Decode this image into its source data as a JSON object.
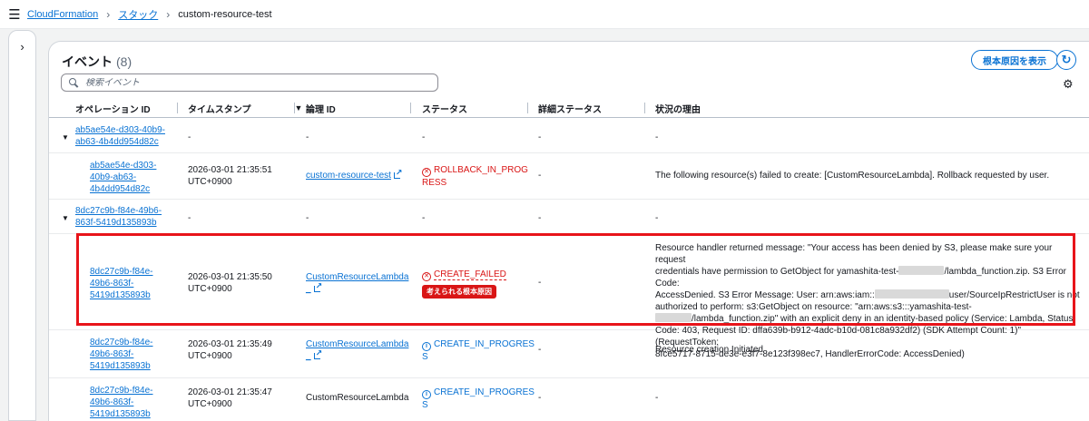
{
  "breadcrumb": {
    "items": [
      {
        "label": "CloudFormation"
      },
      {
        "label": "スタック"
      }
    ],
    "current": "custom-resource-test"
  },
  "panel": {
    "title": "イベント",
    "count": "(8)",
    "root_cause_button": "根本原因を表示",
    "search_placeholder": "検索イベント"
  },
  "table": {
    "headers": {
      "operation_id": "オペレーション ID",
      "timestamp": "タイムスタンプ",
      "logical_id": "論理 ID",
      "status": "ステータス",
      "detailed_status": "詳細ステータス",
      "reason": "状況の理由"
    },
    "rows": [
      {
        "group": true,
        "operation_id": [
          "ab5ae54e-d303-40b9-",
          "ab63-4b4dd954d82c"
        ],
        "timestamp": "-",
        "logical_id": "-",
        "status": "-",
        "detailed_status": "-",
        "reason": "-"
      },
      {
        "operation_id": [
          "ab5ae54e-d303-",
          "40b9-ab63-",
          "4b4dd954d82c"
        ],
        "timestamp": [
          "2026-03-01 21:35:51",
          "UTC+0900"
        ],
        "logical_id": "custom-resource-test",
        "status": [
          "ROLLBACK_IN_PROG",
          "RESS"
        ],
        "detailed_status": "-",
        "reason": "The following resource(s) failed to create: [CustomResourceLambda]. Rollback requested by user."
      },
      {
        "group": true,
        "operation_id": [
          "8dc27c9b-f84e-49b6-",
          "863f-5419d135893b"
        ],
        "timestamp": "-",
        "logical_id": "-",
        "status": "-",
        "detailed_status": "-",
        "reason": "-"
      },
      {
        "operation_id": [
          "8dc27c9b-f84e-",
          "49b6-863f-",
          "5419d135893b"
        ],
        "timestamp": [
          "2026-03-01 21:35:50",
          "UTC+0900"
        ],
        "logical_id": [
          "CustomResourceLambda",
          "_"
        ],
        "status": [
          "CREATE_FAILED"
        ],
        "status_badge": "考えられる根本原因",
        "detailed_status": "-",
        "reason_lines": [
          "Resource handler returned message: \"Your access has been denied by S3, please make sure your request",
          "credentials have permission to GetObject for yamashita-test-",
          "/lambda_function.zip. S3 Error Code:",
          "AccessDenied. S3 Error Message: User: arn:aws:iam::",
          "user/SourceIpRestrictUser is not",
          "authorized to perform: s3:GetObject on resource: \"arn:aws:s3:::yamashita-test-",
          "/lambda_function.zip\" with an explicit deny in an identity-based policy (Service: Lambda, Status",
          "Code: 403, Request ID: dffa639b-b912-4adc-b10d-081c8a932df2) (SDK Attempt Count: 1)\" (RequestToken:",
          "8fce5717-8715-de3e-e3f7-8e123f398ec7, HandlerErrorCode: AccessDenied)"
        ]
      },
      {
        "operation_id": [
          "8dc27c9b-f84e-",
          "49b6-863f-",
          "5419d135893b"
        ],
        "timestamp": [
          "2026-03-01 21:35:49",
          "UTC+0900"
        ],
        "logical_id": [
          "CustomResourceLambda",
          "_"
        ],
        "status": [
          "CREATE_IN_PROGRES",
          "S"
        ],
        "detailed_status": "-",
        "reason": "Resource creation Initiated"
      },
      {
        "operation_id": [
          "8dc27c9b-f84e-",
          "49b6-863f-",
          "5419d135893b"
        ],
        "timestamp": [
          "2026-03-01 21:35:47",
          "UTC+0900"
        ],
        "logical_id": "CustomResourceLambda",
        "status": [
          "CREATE_IN_PROGRES",
          "S"
        ],
        "detailed_status": "-",
        "reason": "-"
      }
    ]
  },
  "colors": {
    "link": "#0972d3",
    "error": "#d91515",
    "highlight": "#e8141a"
  }
}
